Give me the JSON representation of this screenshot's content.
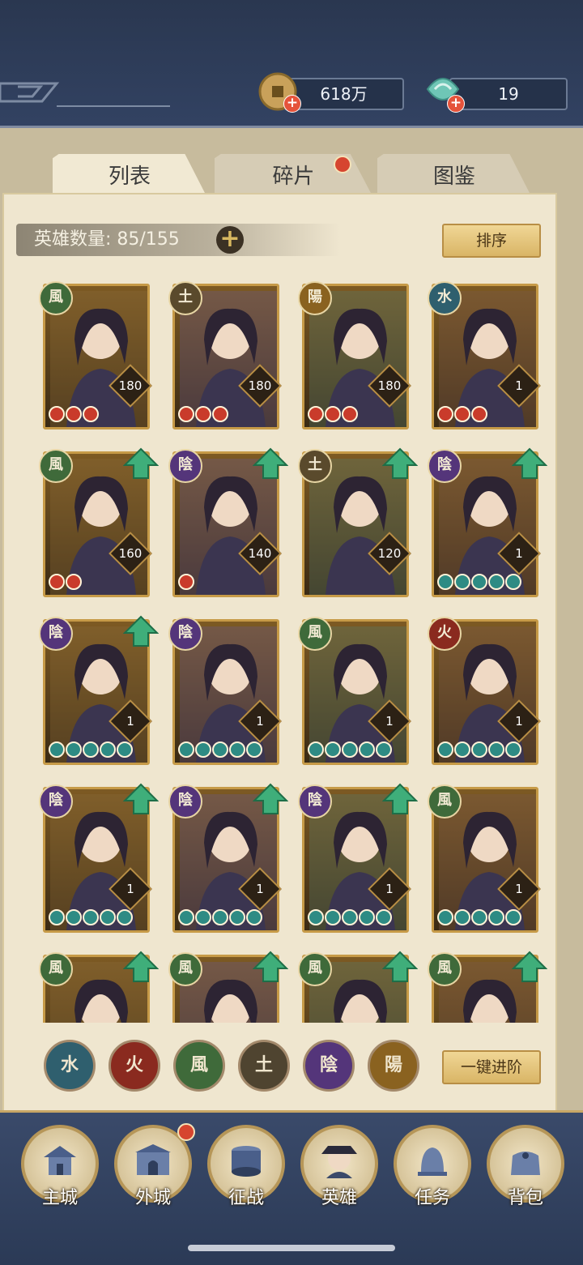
{
  "resources": {
    "coins": "618万",
    "jade": "19"
  },
  "tabs": [
    {
      "label": "列表",
      "active": true
    },
    {
      "label": "碎片",
      "active": false,
      "badge": true
    },
    {
      "label": "图鉴",
      "active": false
    }
  ],
  "hero_count": {
    "label": "英雄数量: 85/155"
  },
  "sort_label": "排序",
  "heroes": [
    {
      "element": "風",
      "level": "180",
      "stars": 3,
      "star_color": "red",
      "upgrade": false
    },
    {
      "element": "土",
      "level": "180",
      "stars": 3,
      "star_color": "red",
      "upgrade": false
    },
    {
      "element": "陽",
      "level": "180",
      "stars": 3,
      "star_color": "red",
      "upgrade": false
    },
    {
      "element": "水",
      "level": "1",
      "stars": 3,
      "star_color": "red",
      "upgrade": false
    },
    {
      "element": "風",
      "level": "160",
      "stars": 2,
      "star_color": "red",
      "upgrade": true
    },
    {
      "element": "陰",
      "level": "140",
      "stars": 1,
      "star_color": "red",
      "upgrade": true
    },
    {
      "element": "土",
      "level": "120",
      "stars": 0,
      "star_color": "red",
      "upgrade": true
    },
    {
      "element": "陰",
      "level": "1",
      "stars": 5,
      "star_color": "teal",
      "upgrade": true
    },
    {
      "element": "陰",
      "level": "1",
      "stars": 5,
      "star_color": "teal",
      "upgrade": true
    },
    {
      "element": "陰",
      "level": "1",
      "stars": 5,
      "star_color": "teal",
      "upgrade": false
    },
    {
      "element": "風",
      "level": "1",
      "stars": 5,
      "star_color": "teal",
      "upgrade": false
    },
    {
      "element": "火",
      "level": "1",
      "stars": 5,
      "star_color": "teal",
      "upgrade": false
    },
    {
      "element": "陰",
      "level": "1",
      "stars": 5,
      "star_color": "teal",
      "upgrade": true
    },
    {
      "element": "陰",
      "level": "1",
      "stars": 5,
      "star_color": "teal",
      "upgrade": true
    },
    {
      "element": "陰",
      "level": "1",
      "stars": 5,
      "star_color": "teal",
      "upgrade": true
    },
    {
      "element": "風",
      "level": "1",
      "stars": 5,
      "star_color": "teal",
      "upgrade": false
    },
    {
      "element": "風",
      "level": "",
      "stars": 0,
      "star_color": "teal",
      "upgrade": true
    },
    {
      "element": "風",
      "level": "",
      "stars": 0,
      "star_color": "teal",
      "upgrade": true
    },
    {
      "element": "風",
      "level": "",
      "stars": 0,
      "star_color": "teal",
      "upgrade": true
    },
    {
      "element": "風",
      "level": "",
      "stars": 0,
      "star_color": "teal",
      "upgrade": true
    }
  ],
  "element_filters": [
    {
      "glyph": "水",
      "color": "#2f5f6e"
    },
    {
      "glyph": "火",
      "color": "#8a2a1f"
    },
    {
      "glyph": "風",
      "color": "#3f6a3a"
    },
    {
      "glyph": "土",
      "color": "#4f4430"
    },
    {
      "glyph": "陰",
      "color": "#54357a"
    },
    {
      "glyph": "陽",
      "color": "#8a6220"
    }
  ],
  "element_colors": {
    "風": "#3f6a3a",
    "土": "#5a4a2c",
    "陽": "#8a6220",
    "水": "#2f5f6e",
    "陰": "#54357a",
    "火": "#8a2a1f"
  },
  "ascend_label": "一键进阶",
  "nav": [
    {
      "label": "主城",
      "icon": "palace-icon",
      "badge": false
    },
    {
      "label": "外城",
      "icon": "city-gate-icon",
      "badge": true
    },
    {
      "label": "征战",
      "icon": "war-drum-icon",
      "badge": false
    },
    {
      "label": "英雄",
      "icon": "hero-portrait-icon",
      "badge": false
    },
    {
      "label": "任务",
      "icon": "bell-icon",
      "badge": false
    },
    {
      "label": "背包",
      "icon": "bag-icon",
      "badge": false
    }
  ]
}
